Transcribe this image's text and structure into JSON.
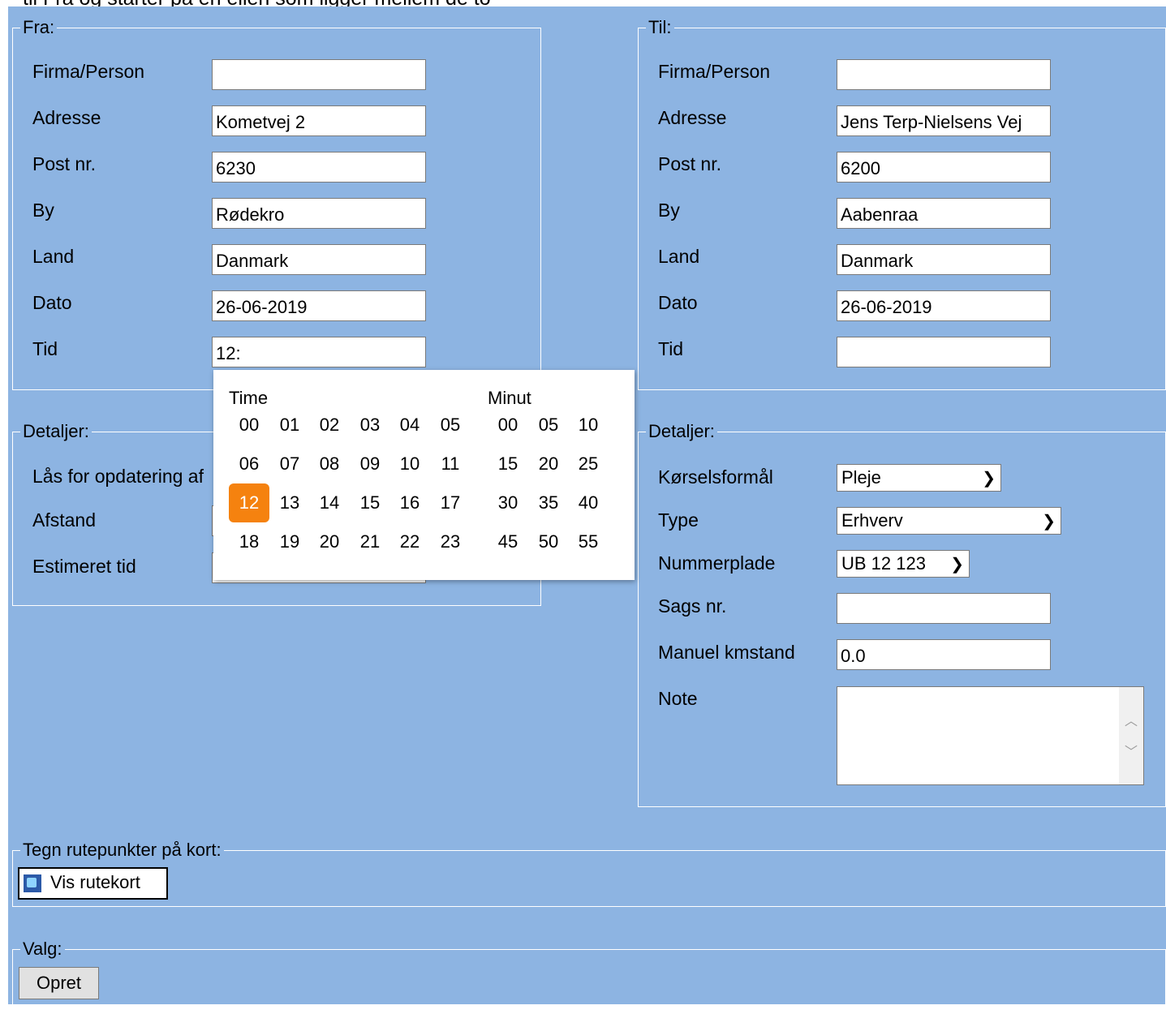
{
  "top_cut_text": "til  Fra og starter på en ellen som ligger mellem de to",
  "fra": {
    "legend": "Fra:",
    "fields": [
      {
        "label": "Firma/Person",
        "value": ""
      },
      {
        "label": "Adresse",
        "value": "Kometvej 2"
      },
      {
        "label": "Post nr.",
        "value": "6230"
      },
      {
        "label": "By",
        "value": "Rødekro"
      },
      {
        "label": "Land",
        "value": "Danmark"
      },
      {
        "label": "Dato",
        "value": "26-06-2019"
      },
      {
        "label": "Tid",
        "value": "12:"
      }
    ]
  },
  "til": {
    "legend": "Til:",
    "fields": [
      {
        "label": "Firma/Person",
        "value": ""
      },
      {
        "label": "Adresse",
        "value": "Jens Terp-Nielsens Vej"
      },
      {
        "label": "Post nr.",
        "value": "6200"
      },
      {
        "label": "By",
        "value": "Aabenraa"
      },
      {
        "label": "Land",
        "value": "Danmark"
      },
      {
        "label": "Dato",
        "value": "26-06-2019"
      },
      {
        "label": "Tid",
        "value": ""
      }
    ]
  },
  "detaljer_left": {
    "legend": "Detaljer:",
    "lock_label": "Lås for opdatering af",
    "afstand_label": "Afstand",
    "estimeret_label": "Estimeret tid"
  },
  "detaljer_right": {
    "legend": "Detaljer:",
    "korselsformal": {
      "label": "Kørselsformål",
      "value": "Pleje"
    },
    "type": {
      "label": "Type",
      "value": "Erhverv"
    },
    "nummerplade": {
      "label": "Nummerplade",
      "value": "UB 12 123"
    },
    "sags_nr": {
      "label": "Sags nr.",
      "value": ""
    },
    "manuel_km": {
      "label": "Manuel kmstand",
      "value": "0.0"
    },
    "note": {
      "label": "Note",
      "value": ""
    }
  },
  "rute": {
    "legend": "Tegn rutepunkter på kort:",
    "button": "Vis rutekort",
    "icon": "map-icon"
  },
  "valg": {
    "legend": "Valg:",
    "button": "Opret"
  },
  "time_picker": {
    "hour_header": "Time",
    "minute_header": "Minut",
    "hours": [
      [
        "00",
        "01",
        "02",
        "03",
        "04",
        "05"
      ],
      [
        "06",
        "07",
        "08",
        "09",
        "10",
        "11"
      ],
      [
        "12",
        "13",
        "14",
        "15",
        "16",
        "17"
      ],
      [
        "18",
        "19",
        "20",
        "21",
        "22",
        "23"
      ]
    ],
    "minutes": [
      [
        "00",
        "05",
        "10"
      ],
      [
        "15",
        "20",
        "25"
      ],
      [
        "30",
        "35",
        "40"
      ],
      [
        "45",
        "50",
        "55"
      ]
    ],
    "selected_hour": "12",
    "highlight_color": "#f5820f"
  },
  "colors": {
    "panel_bg": "#8db4e2",
    "border": "#ffffff"
  }
}
